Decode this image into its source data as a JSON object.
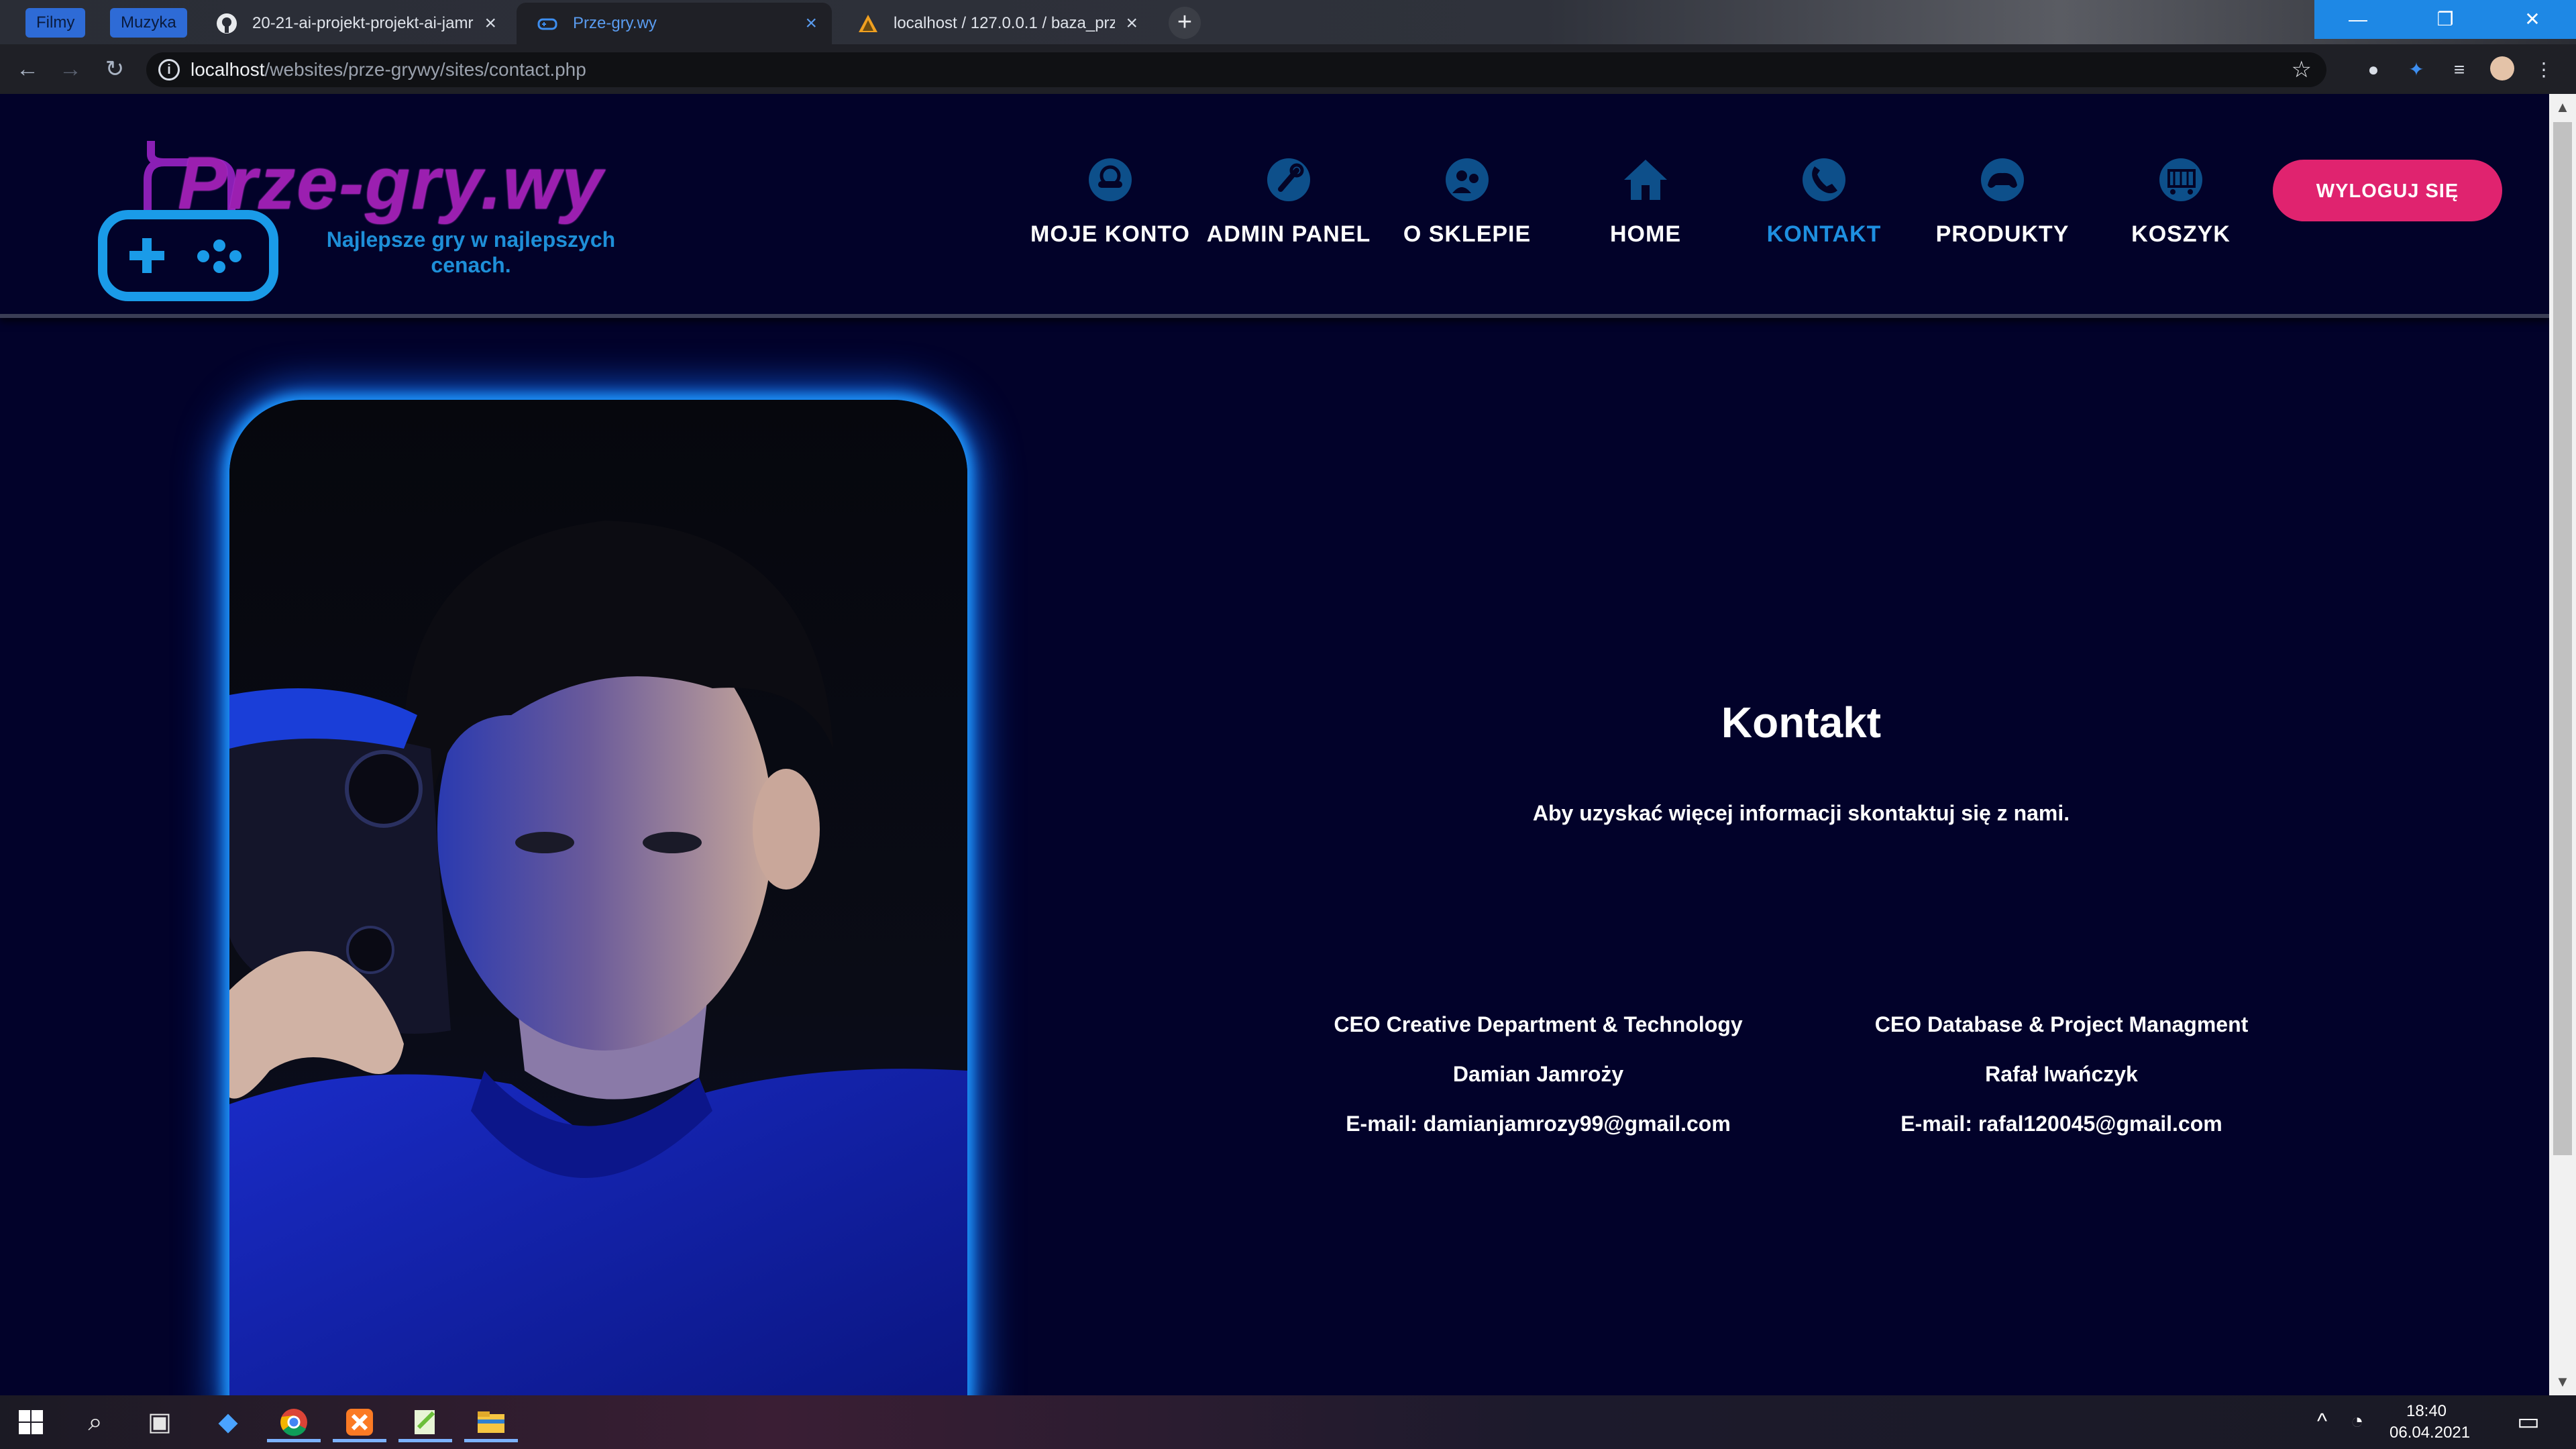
{
  "browser": {
    "bookmarks": [
      "Filmy",
      "Muzyka"
    ],
    "tabs": [
      {
        "label": "20-21-ai-projekt-projekt-ai-jamr",
        "active": false
      },
      {
        "label": "Prze-gry.wy",
        "active": true
      },
      {
        "label": "localhost / 127.0.0.1 / baza_przeg",
        "active": false
      }
    ],
    "new_tab": "+",
    "url_host": "localhost",
    "url_path": "/websites/prze-grywy/sites/contact.php"
  },
  "site": {
    "logo": {
      "title": "Prze-gry.wy",
      "tagline": "Najlepsze gry w najlepszych cenach."
    },
    "nav": [
      {
        "label": "MOJE KONTO",
        "icon": "account-icon",
        "active": false
      },
      {
        "label": "ADMIN PANEL",
        "icon": "admin-icon",
        "active": false
      },
      {
        "label": "O SKLEPIE",
        "icon": "about-icon",
        "active": false
      },
      {
        "label": "HOME",
        "icon": "home-icon",
        "active": false
      },
      {
        "label": "KONTAKT",
        "icon": "phone-icon",
        "active": true
      },
      {
        "label": "PRODUKTY",
        "icon": "gamepad-icon",
        "active": false
      },
      {
        "label": "KOSZYK",
        "icon": "cart-icon",
        "active": false
      }
    ],
    "logout_label": "WYLOGUJ SIĘ",
    "contact": {
      "title": "Kontakt",
      "subtitle": "Aby uzyskać więcej informacji skontaktuj się z nami.",
      "people": [
        {
          "role": "CEO Creative Department & Technology",
          "name": "Damian Jamroży",
          "email": "E-mail: damianjamrozy99@gmail.com"
        },
        {
          "role": "CEO Database & Project Managment",
          "name": "Rafał Iwańczyk",
          "email": "E-mail: rafal120045@gmail.com"
        }
      ]
    }
  },
  "taskbar": {
    "time": "18:40",
    "date": "06.04.2021"
  },
  "colors": {
    "background": "#02022a",
    "accent_blue": "#1e8fe0",
    "logo_purple": "#9b1fb0",
    "logout_pink": "#e0236f"
  }
}
